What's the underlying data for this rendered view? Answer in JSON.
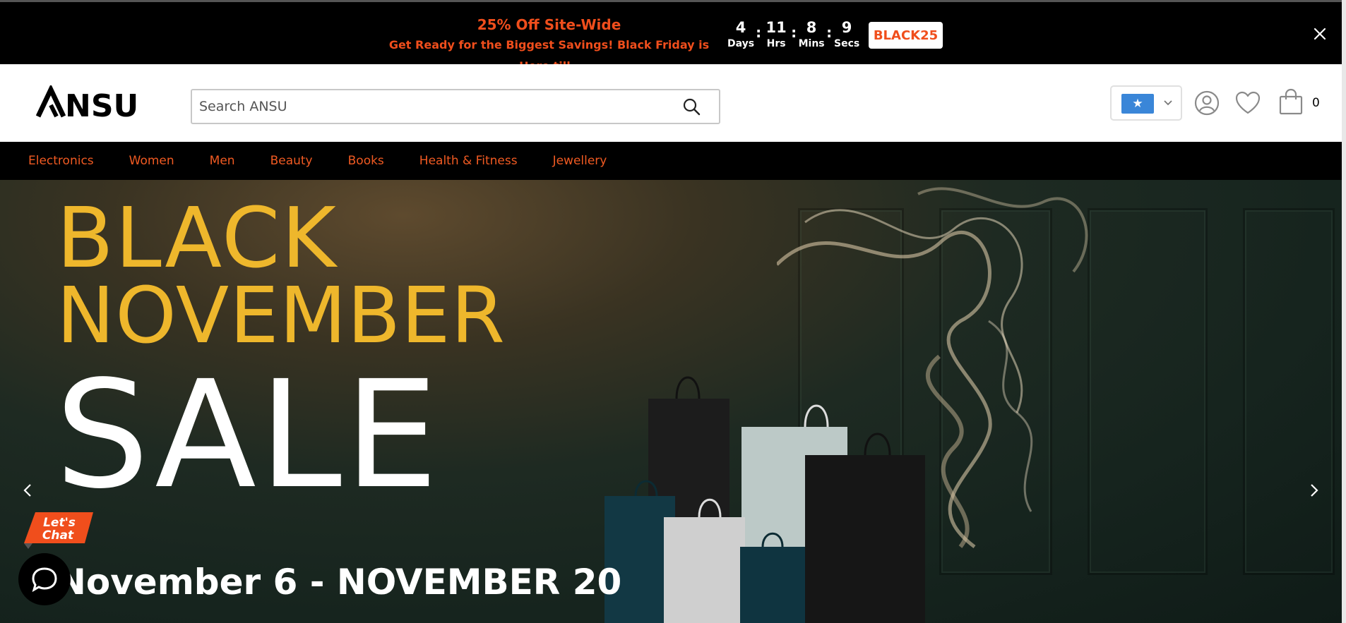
{
  "promo": {
    "title": "25% Off Site-Wide",
    "subtitle": "Get Ready for the Biggest Savings! Black Friday is Here till..",
    "countdown": [
      {
        "value": "4",
        "label": "Days"
      },
      {
        "value": "11",
        "label": "Hrs"
      },
      {
        "value": "8",
        "label": "Mins"
      },
      {
        "value": "9",
        "label": "Secs"
      }
    ],
    "separator": ":",
    "coupon_code": "BLACK25",
    "close_icon": "close-icon",
    "text_color": "#f04e1c"
  },
  "header": {
    "logo": "ANSU",
    "search_placeholder": "Search ANSU",
    "search_icon": "search-icon",
    "language_flag": "★",
    "cart_count": "0",
    "icons": [
      "user-icon",
      "heart-icon",
      "shopping-bag-icon"
    ]
  },
  "categories": [
    "Electronics",
    "Women",
    "Men",
    "Beauty",
    "Books",
    "Health & Fitness",
    "Jewellery"
  ],
  "hero": {
    "line1": "BLACK",
    "line2": "NOVEMBER",
    "line3": "SALE",
    "dates": "November 6 - NOVEMBER 20",
    "accent": "#eeb72c"
  },
  "chat": {
    "badge_line1": "Let's",
    "badge_line2": "Chat"
  }
}
